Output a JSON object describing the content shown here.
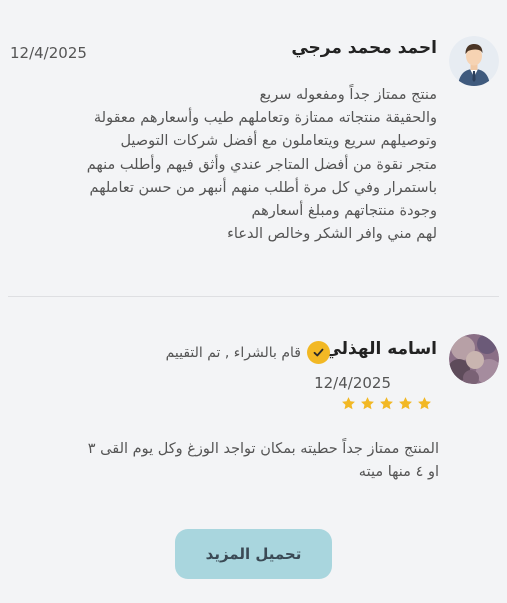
{
  "reviews": [
    {
      "name": "احمد محمد مرجي",
      "date": "12/4/2025",
      "avatar": "user-avatar-icon",
      "lines": [
        "منتج ممتاز جداً ومفعوله سريع",
        "والحقيقة منتجاته ممتازة وتعاملهم طيب وأسعارهم معقولة",
        "وتوصيلهم سريع ويتعاملون مع أفضل شركات التوصيل",
        "متجر نقوة من أفضل المتاجر عندي وأثق فيهم وأطلب منهم",
        "باستمرار وفي كل مرة أطلب منهم أنبهر من حسن تعاملهم",
        "وجودة منتجاتهم ومبلغ أسعارهم",
        "لهم مني وافر الشكر وخالص الدعاء"
      ]
    },
    {
      "name": "اسامه الهذلي",
      "date": "12/4/2025",
      "avatar": "photo-avatar",
      "status": "قام بالشراء , تم التقييم",
      "rating": 5,
      "lines": [
        "المنتج ممتاز جداً حطيته بمكان تواجد الوزغ وكل يوم القى ٣",
        "او ٤ منها ميته"
      ]
    }
  ],
  "load_more_label": "تحميل المزيد",
  "colors": {
    "accent": "#f2b824",
    "button_bg": "#a9d6de",
    "star": "#f2b824"
  }
}
